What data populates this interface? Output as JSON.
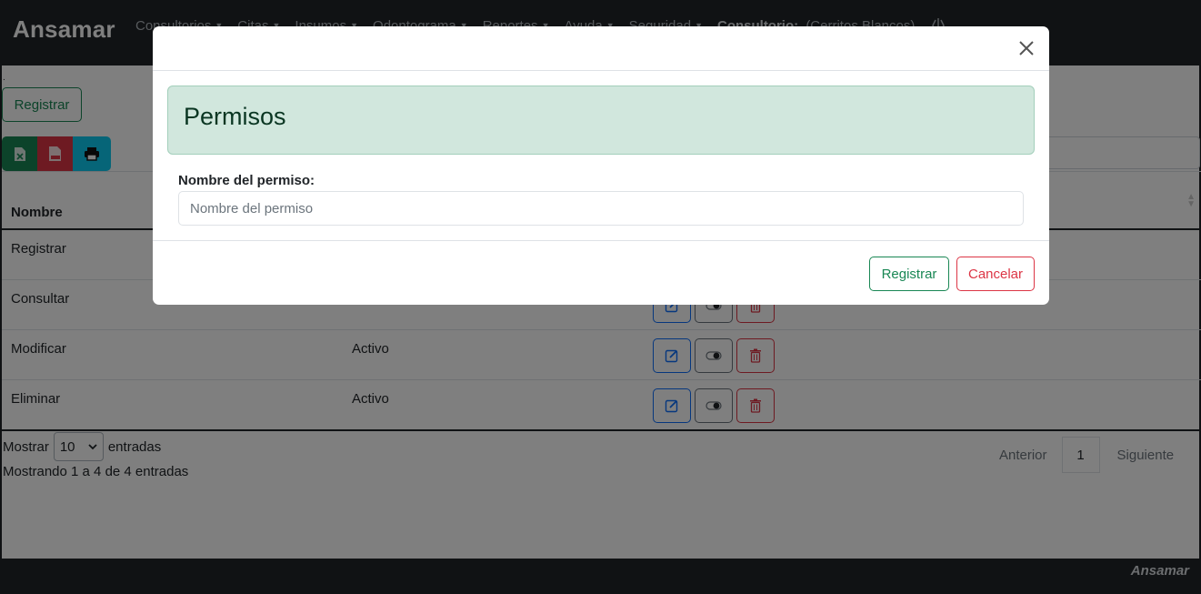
{
  "navbar": {
    "brand": "Ansamar",
    "items": [
      {
        "label": "Consultorios"
      },
      {
        "label": "Citas"
      },
      {
        "label": "Insumos"
      },
      {
        "label": "Odontograma"
      },
      {
        "label": "Reportes"
      },
      {
        "label": "Ayuda"
      },
      {
        "label": "Seguridad"
      }
    ],
    "consultorio_label": "Consultorio:",
    "consultorio_value": "(Cerritos Blancos)"
  },
  "page": {
    "dot": ".",
    "register_label": "Registrar"
  },
  "table": {
    "header_name": "Nombre",
    "rows": [
      {
        "name": "Registrar",
        "state": ""
      },
      {
        "name": "Consultar",
        "state": ""
      },
      {
        "name": "Modificar",
        "state": "Activo"
      },
      {
        "name": "Eliminar",
        "state": "Activo"
      }
    ]
  },
  "length": {
    "prefix": "Mostrar",
    "value": "10",
    "suffix": "entradas"
  },
  "info": "Mostrando 1 a 4 de 4 entradas",
  "pagination": {
    "prev": "Anterior",
    "current": "1",
    "next": "Siguiente"
  },
  "footer": {
    "brand": "Ansamar"
  },
  "modal": {
    "title": "Permisos",
    "field_label": "Nombre del permiso:",
    "field_placeholder": "Nombre del permiso",
    "field_value": "",
    "submit_label": "Registrar",
    "cancel_label": "Cancelar"
  },
  "colors": {
    "navbar": "#212529",
    "success": "#198754",
    "danger": "#dc3545",
    "info": "#0dcaf0",
    "primary": "#0d6efd",
    "alert_bg": "#d1e7dd"
  }
}
